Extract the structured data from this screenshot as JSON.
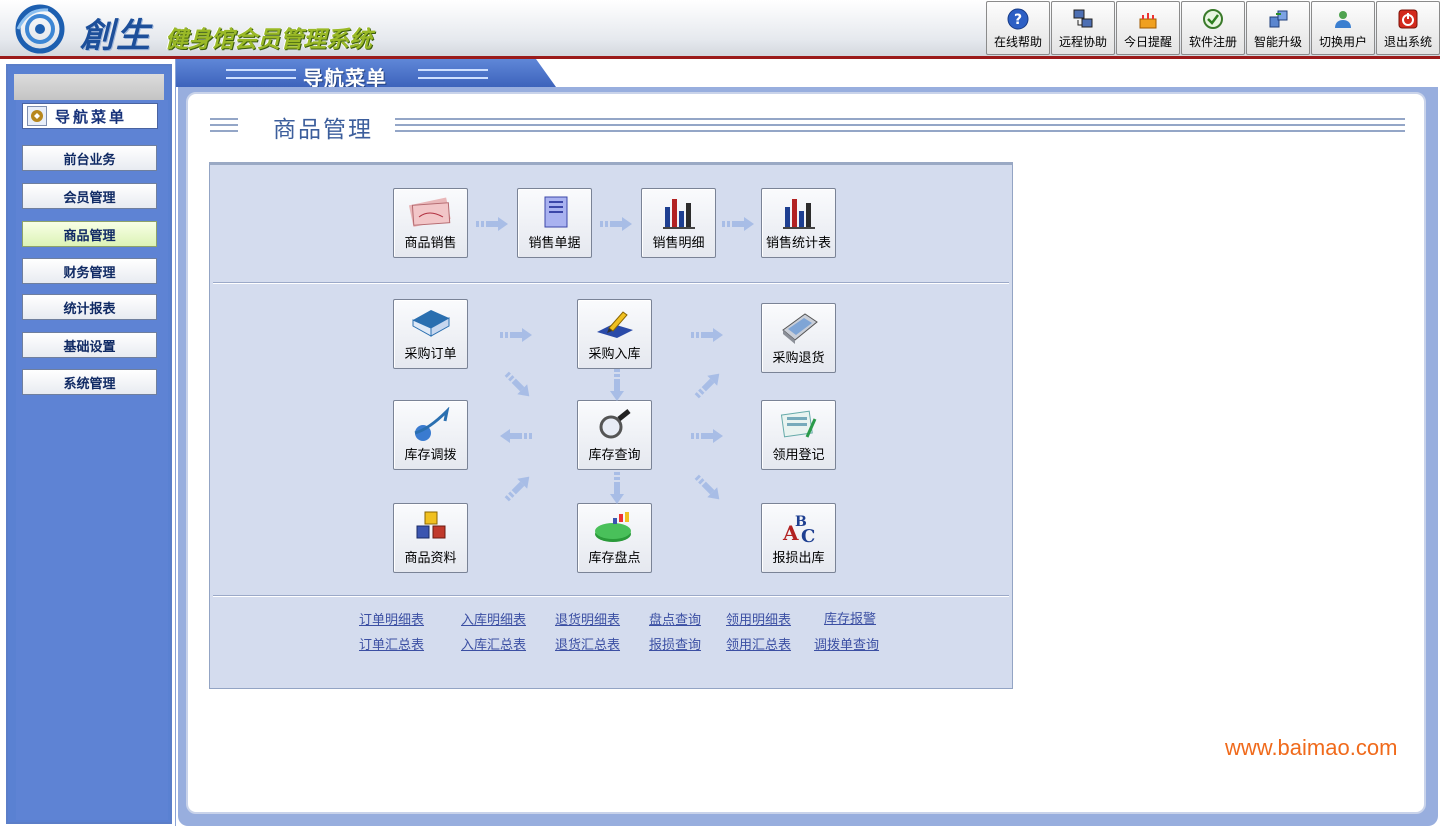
{
  "header": {
    "brand": "創生",
    "app_title": "健身馆会员管理系统",
    "toolbar": [
      {
        "label": "在线帮助",
        "icon": "help-icon"
      },
      {
        "label": "远程协助",
        "icon": "remote-assist-icon"
      },
      {
        "label": "今日提醒",
        "icon": "cake-reminder-icon"
      },
      {
        "label": "软件注册",
        "icon": "register-icon"
      },
      {
        "label": "智能升级",
        "icon": "upgrade-icon"
      },
      {
        "label": "切换用户",
        "icon": "switch-user-icon"
      },
      {
        "label": "退出系统",
        "icon": "power-exit-icon"
      }
    ]
  },
  "sidebar": {
    "header": "导航菜单",
    "items": [
      {
        "label": "前台业务"
      },
      {
        "label": "会员管理"
      },
      {
        "label": "商品管理",
        "active": true
      },
      {
        "label": "财务管理"
      },
      {
        "label": "统计报表"
      },
      {
        "label": "基础设置"
      },
      {
        "label": "系统管理"
      }
    ]
  },
  "main": {
    "tab_title": "导航菜单",
    "section_title": "商品管理",
    "modules": {
      "sales": {
        "label": "商品销售",
        "icon": "money-icon"
      },
      "sales_doc": {
        "label": "销售单据",
        "icon": "notebook-icon"
      },
      "sales_detail": {
        "label": "销售明细",
        "icon": "bar-chart-icon"
      },
      "sales_stats": {
        "label": "销售统计表",
        "icon": "bar-chart-icon"
      },
      "purchase_order": {
        "label": "采购订单",
        "icon": "book-icon"
      },
      "purchase_in": {
        "label": "采购入库",
        "icon": "pen-icon"
      },
      "purchase_return": {
        "label": "采购退货",
        "icon": "tablet-icon"
      },
      "transfer": {
        "label": "库存调拨",
        "icon": "globe-arrow-icon"
      },
      "stock_query": {
        "label": "库存查询",
        "icon": "magnifier-icon"
      },
      "requisition": {
        "label": "领用登记",
        "icon": "pages-pen-icon"
      },
      "goods_info": {
        "label": "商品资料",
        "icon": "blocks-icon"
      },
      "stocktake": {
        "label": "库存盘点",
        "icon": "pie-chart-icon"
      },
      "damage_out": {
        "label": "报损出库",
        "icon": "abc-icon"
      }
    },
    "links": {
      "row1": [
        "订单明细表",
        "入库明细表",
        "退货明细表",
        "盘点查询",
        "领用明细表",
        "库存报警"
      ],
      "row2": [
        "订单汇总表",
        "入库汇总表",
        "退货汇总表",
        "报损查询",
        "领用汇总表",
        "调拨单查询"
      ]
    }
  },
  "watermark": "www.baimao.com",
  "colors": {
    "accent_blue": "#5a81d2",
    "header_rule": "#9b1a1a",
    "panel_bg": "#d4dcee",
    "link": "#3b4fa3",
    "watermark": "#f06a1b"
  }
}
